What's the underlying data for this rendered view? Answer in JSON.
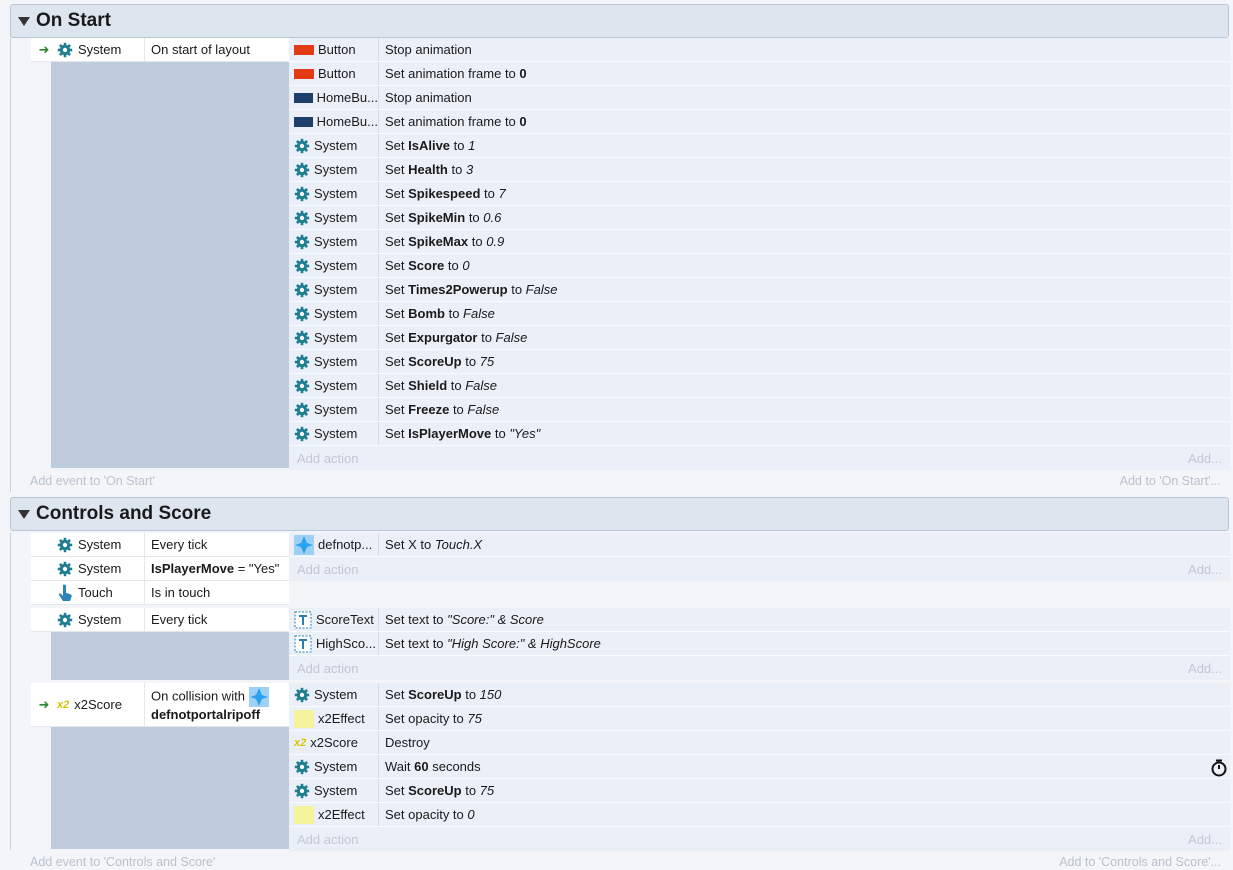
{
  "groups": [
    {
      "title": "On Start",
      "add_event": "Add event to 'On Start'",
      "add_to": "Add to 'On Start'..."
    },
    {
      "title": "Controls and Score",
      "add_event": "Add event to 'Controls and Score'",
      "add_to": "Add to 'Controls and Score'..."
    }
  ],
  "add_action": "Add action",
  "add": "Add...",
  "on_start_event": {
    "condition": {
      "object": "System",
      "text": "On start of layout"
    },
    "actions": [
      {
        "icon": "red-square",
        "object": "Button",
        "pre": "Stop animation",
        "bold": "",
        "mid": "",
        "val": ""
      },
      {
        "icon": "red-square",
        "object": "Button",
        "pre": "Set animation frame to ",
        "bold": "0",
        "mid": "",
        "val": ""
      },
      {
        "icon": "blue-square",
        "object": "HomeBu...",
        "pre": "Stop animation",
        "bold": "",
        "mid": "",
        "val": ""
      },
      {
        "icon": "blue-square",
        "object": "HomeBu...",
        "pre": "Set animation frame to ",
        "bold": "0",
        "mid": "",
        "val": ""
      },
      {
        "icon": "gear",
        "object": "System",
        "pre": "Set ",
        "bold": "IsAlive",
        "mid": " to ",
        "val": "1"
      },
      {
        "icon": "gear",
        "object": "System",
        "pre": "Set ",
        "bold": "Health",
        "mid": " to ",
        "val": "3"
      },
      {
        "icon": "gear",
        "object": "System",
        "pre": "Set ",
        "bold": "Spikespeed",
        "mid": " to ",
        "val": "7"
      },
      {
        "icon": "gear",
        "object": "System",
        "pre": "Set ",
        "bold": "SpikeMin",
        "mid": " to ",
        "val": "0.6"
      },
      {
        "icon": "gear",
        "object": "System",
        "pre": "Set ",
        "bold": "SpikeMax",
        "mid": " to ",
        "val": "0.9"
      },
      {
        "icon": "gear",
        "object": "System",
        "pre": "Set ",
        "bold": "Score",
        "mid": " to ",
        "val": "0"
      },
      {
        "icon": "gear",
        "object": "System",
        "pre": "Set ",
        "bold": "Times2Powerup",
        "mid": " to ",
        "val": "False"
      },
      {
        "icon": "gear",
        "object": "System",
        "pre": "Set ",
        "bold": "Bomb",
        "mid": " to ",
        "val": "False"
      },
      {
        "icon": "gear",
        "object": "System",
        "pre": "Set ",
        "bold": "Expurgator",
        "mid": " to ",
        "val": "False"
      },
      {
        "icon": "gear",
        "object": "System",
        "pre": "Set ",
        "bold": "ScoreUp",
        "mid": " to ",
        "val": "75"
      },
      {
        "icon": "gear",
        "object": "System",
        "pre": "Set ",
        "bold": "Shield",
        "mid": " to ",
        "val": "False"
      },
      {
        "icon": "gear",
        "object": "System",
        "pre": "Set ",
        "bold": "Freeze",
        "mid": " to ",
        "val": "False"
      },
      {
        "icon": "gear",
        "object": "System",
        "pre": "Set ",
        "bold": "IsPlayerMove",
        "mid": " to ",
        "val": "\"Yes\""
      }
    ]
  },
  "controls_event1": {
    "conditions": [
      {
        "icon": "gear",
        "object": "System",
        "text": "Every tick",
        "bold": ""
      },
      {
        "icon": "gear",
        "object": "System",
        "text": " = \"Yes\"",
        "bold": "IsPlayerMove"
      },
      {
        "icon": "hand",
        "object": "Touch",
        "text": "Is in touch",
        "bold": ""
      }
    ],
    "actions": [
      {
        "icon": "sprite",
        "object": "defnotp...",
        "pre": "Set X to ",
        "bold": "",
        "mid": "",
        "val": "Touch.X"
      }
    ]
  },
  "controls_event2": {
    "conditions": [
      {
        "icon": "gear",
        "object": "System",
        "text": "Every tick",
        "bold": ""
      }
    ],
    "actions": [
      {
        "icon": "text",
        "object": "ScoreText",
        "pre": "Set text to ",
        "bold": "",
        "mid": "",
        "val": "\"Score:\" & Score"
      },
      {
        "icon": "text",
        "object": "HighSco...",
        "pre": "Set text to ",
        "bold": "",
        "mid": "",
        "val": "\"High Score:\" & HighScore"
      }
    ]
  },
  "controls_event3": {
    "condition": {
      "object": "x2Score",
      "text": "On collision with",
      "bold": "defnotportalripoff"
    },
    "actions": [
      {
        "icon": "gear",
        "object": "System",
        "pre": "Set ",
        "bold": "ScoreUp",
        "mid": " to ",
        "val": "150"
      },
      {
        "icon": "yellow",
        "object": "x2Effect",
        "pre": "Set opacity to ",
        "bold": "",
        "mid": "",
        "val": "75"
      },
      {
        "icon": "x2",
        "object": "x2Score",
        "pre": "Destroy",
        "bold": "",
        "mid": "",
        "val": ""
      },
      {
        "icon": "gear",
        "object": "System",
        "pre": "Wait ",
        "bold": "60",
        "mid": " seconds",
        "val": ""
      },
      {
        "icon": "gear",
        "object": "System",
        "pre": "Set ",
        "bold": "ScoreUp",
        "mid": " to ",
        "val": "75"
      },
      {
        "icon": "yellow",
        "object": "x2Effect",
        "pre": "Set opacity to ",
        "bold": "",
        "mid": "",
        "val": "0"
      }
    ]
  },
  "x2_label": "x2"
}
